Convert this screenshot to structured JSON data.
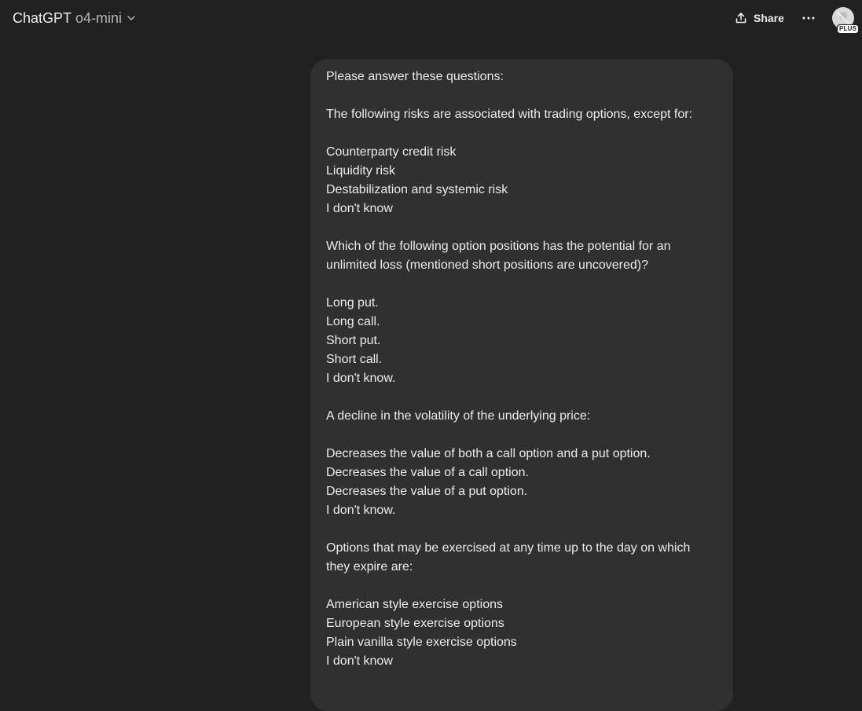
{
  "header": {
    "app_name": "ChatGPT",
    "model_name": "o4-mini",
    "share_label": "Share",
    "avatar_badge": "PLUS"
  },
  "icons": {
    "chevron": "chevron-down-icon",
    "share": "share-icon",
    "more": "more-horizontal-icon",
    "avatar": "user-avatar-icon"
  },
  "colors": {
    "background": "#212121",
    "bubble": "#303030",
    "text": "#ececec",
    "muted": "#b4b4b4"
  },
  "message": {
    "text": "Please answer these questions:\n\nThe following risks are associated with trading options, except for:\n\nCounterparty credit risk\nLiquidity risk\nDestabilization and systemic risk\nI don't know\n\nWhich of the following option positions has the potential for an unlimited loss (mentioned short positions are uncovered)?\n\nLong put.\nLong call.\nShort put.\nShort call.\nI don't know.\n\nA decline in the volatility of the underlying price:\n\nDecreases the value of both a call option and a put option.\nDecreases the value of a call option.\nDecreases the value of a put option.\nI don't know.\n\nOptions that may be exercised at any time up to the day on which they expire are:\n\nAmerican style exercise options\nEuropean style exercise options\nPlain vanilla style exercise options\nI don't know"
  }
}
